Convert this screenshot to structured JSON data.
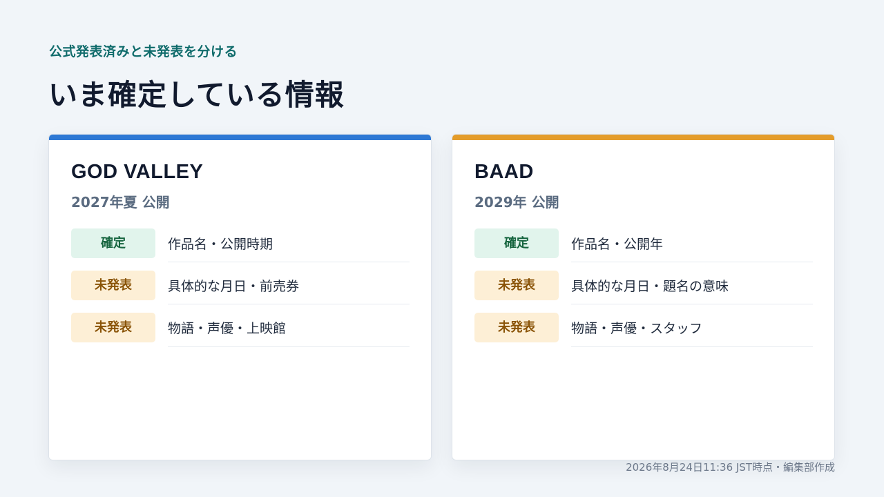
{
  "header": {
    "eyebrow": "公式発表済みと未発表を分ける",
    "title": "いま確定している情報"
  },
  "colors": {
    "card_a_accent": "#2d78d4",
    "card_b_accent": "#e49c2a",
    "confirmed_bg": "#e1f4ec",
    "pending_bg": "#fdefd6"
  },
  "cards": [
    {
      "title": "GOD VALLEY",
      "subtitle": "2027年夏 公開",
      "rows": [
        {
          "badge": "確定",
          "status": "confirmed",
          "text": "作品名・公開時期"
        },
        {
          "badge": "未発表",
          "status": "pending",
          "text": "具体的な月日・前売券"
        },
        {
          "badge": "未発表",
          "status": "pending",
          "text": "物語・声優・上映館"
        }
      ]
    },
    {
      "title": "BAAD",
      "subtitle": "2029年 公開",
      "rows": [
        {
          "badge": "確定",
          "status": "confirmed",
          "text": "作品名・公開年"
        },
        {
          "badge": "未発表",
          "status": "pending",
          "text": "具体的な月日・題名の意味"
        },
        {
          "badge": "未発表",
          "status": "pending",
          "text": "物語・声優・スタッフ"
        }
      ]
    }
  ],
  "footnote": "2026年8月24日11:36 JST時点・編集部作成"
}
